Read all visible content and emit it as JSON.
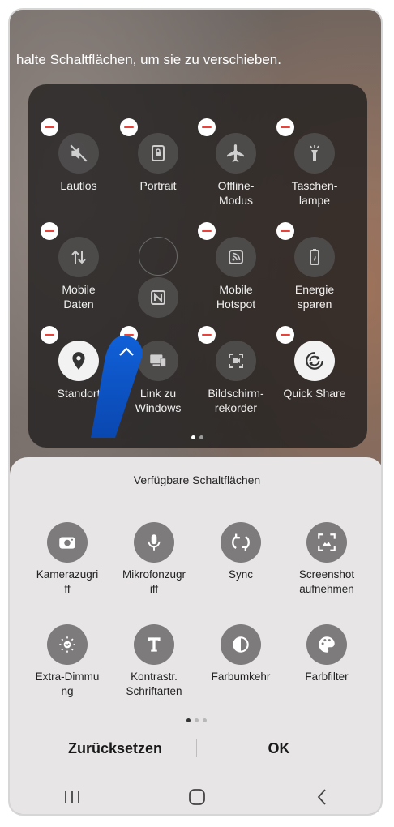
{
  "hint": "halte Schaltflächen, um sie zu verschieben.",
  "panel": {
    "tiles": [
      {
        "label": "Lautlos",
        "icon": "mute-icon"
      },
      {
        "label": "Portrait",
        "icon": "portrait-lock-icon"
      },
      {
        "label": "Offline-Modus",
        "icon": "airplane-icon"
      },
      {
        "label": "Taschen-lampe",
        "icon": "flashlight-icon"
      },
      {
        "label": "Mobile Daten",
        "icon": "mobile-data-icon"
      },
      {
        "label": "",
        "icon": "nfc-icon"
      },
      {
        "label": "Mobile Hotspot",
        "icon": "hotspot-icon"
      },
      {
        "label": "Energie sparen",
        "icon": "battery-saver-icon"
      },
      {
        "label": "Standort",
        "icon": "location-icon"
      },
      {
        "label": "Link zu Windows",
        "icon": "link-to-windows-icon"
      },
      {
        "label": "Bildschirm-rekorder",
        "icon": "screen-recorder-icon"
      },
      {
        "label": "Quick Share",
        "icon": "quick-share-icon"
      }
    ]
  },
  "sheet": {
    "title": "Verfügbare Schaltflächen",
    "items": [
      {
        "label": "Kamerazugri ff",
        "icon": "camera-access-icon"
      },
      {
        "label": "Mikrofonzugr iff",
        "icon": "microphone-icon"
      },
      {
        "label": "Sync",
        "icon": "sync-icon"
      },
      {
        "label": "Screenshot aufnehmen",
        "icon": "screenshot-icon"
      },
      {
        "label": "Extra-Dimmu ng",
        "icon": "extra-dim-icon"
      },
      {
        "label": "Kontrastr. Schriftarten",
        "icon": "contrast-font-icon"
      },
      {
        "label": "Farbumkehr",
        "icon": "color-invert-icon"
      },
      {
        "label": "Farbfilter",
        "icon": "color-filter-icon"
      }
    ],
    "reset_label": "Zurücksetzen",
    "ok_label": "OK"
  }
}
